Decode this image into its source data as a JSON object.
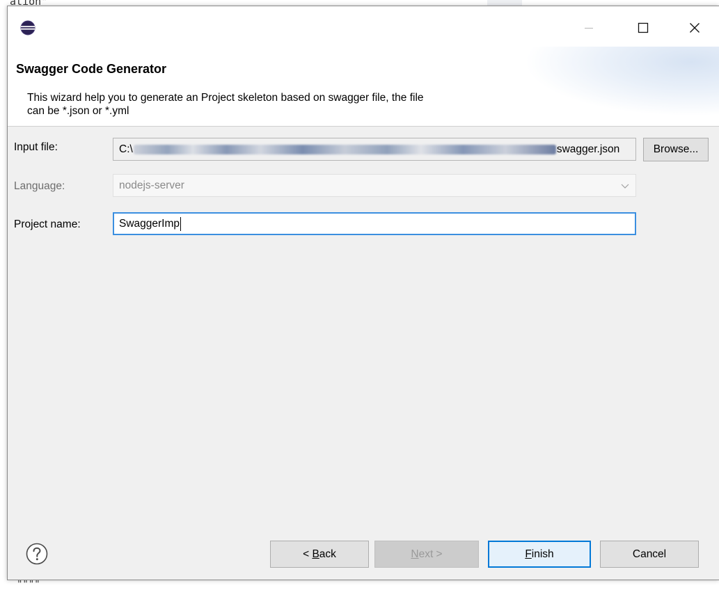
{
  "background": {
    "top_text": "ation\"",
    "bottom_text": "\"\"\"\""
  },
  "window": {
    "icon": "eclipse-icon",
    "controls": {
      "minimize": "minimize-icon",
      "maximize": "maximize-icon",
      "close": "close-icon"
    }
  },
  "header": {
    "title": "Swagger Code Generator",
    "description_line1": "This wizard help you to generate an Project skeleton based on swagger file, the file",
    "description_line2": "can be *.json or *.yml"
  },
  "form": {
    "input_file": {
      "label": "Input file:",
      "value_prefix": "C:\\",
      "value_suffix": "swagger.json",
      "browse_label": "Browse..."
    },
    "language": {
      "label": "Language:",
      "value": "nodejs-server"
    },
    "project_name": {
      "label": "Project name:",
      "value": "SwaggerImp"
    }
  },
  "footer": {
    "help_icon": "help-icon",
    "back": {
      "prefix": "< ",
      "mnemonic": "B",
      "rest": "ack"
    },
    "next": {
      "mnemonic": "N",
      "rest": "ext >"
    },
    "finish": {
      "mnemonic": "F",
      "rest": "inish"
    },
    "cancel_label": "Cancel"
  },
  "colors": {
    "dialog_bg": "#f0f0f0",
    "focus_border": "#3b8fe0",
    "default_button_border": "#0078d7"
  }
}
